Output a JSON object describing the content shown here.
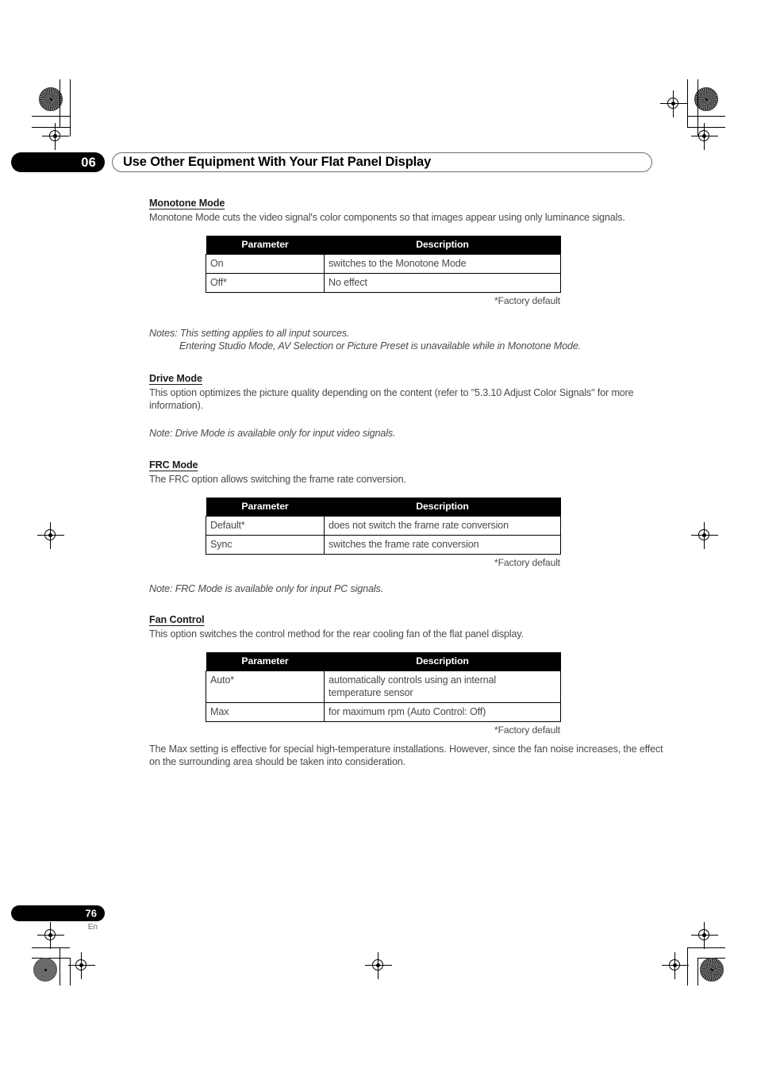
{
  "header": {
    "chapter_number": "06",
    "title": "Use Other Equipment With Your Flat Panel Display"
  },
  "footer": {
    "page_number": "76",
    "language_code": "En"
  },
  "sections": [
    {
      "heading": "Monotone Mode",
      "intro": "Monotone Mode cuts the video signal's color components so that images appear using only luminance signals.",
      "table": {
        "columns": [
          "Parameter",
          "Description"
        ],
        "rows": [
          [
            "On",
            "switches to the Monotone Mode"
          ],
          [
            "Off*",
            "No effect"
          ]
        ],
        "footnote": "*Factory default"
      },
      "notes": [
        "Notes: This setting applies to all input sources.",
        "Entering Studio Mode, AV Selection or Picture Preset is unavailable while in Monotone Mode."
      ]
    },
    {
      "heading": "Drive Mode",
      "intro": "This option optimizes the picture quality depending on the content (refer to \"5.3.10 Adjust Color Signals\" for more information).",
      "notes": [
        "Note: Drive Mode is available only for input video signals."
      ]
    },
    {
      "heading": "FRC Mode",
      "intro": "The FRC option allows switching the frame rate conversion.",
      "table": {
        "columns": [
          "Parameter",
          "Description"
        ],
        "rows": [
          [
            "Default*",
            "does not switch the frame rate conversion"
          ],
          [
            "Sync",
            "switches the frame rate conversion"
          ]
        ],
        "footnote": "*Factory default"
      },
      "notes": [
        "Note: FRC Mode is available only for input PC signals."
      ]
    },
    {
      "heading": "Fan Control",
      "intro": "This option switches the control method for the rear cooling fan of the flat panel display.",
      "table": {
        "columns": [
          "Parameter",
          "Description"
        ],
        "rows": [
          [
            "Auto*",
            "automatically controls using an internal temperature sensor"
          ],
          [
            "Max",
            "for maximum rpm (Auto Control: Off)"
          ]
        ],
        "footnote": "*Factory default"
      },
      "closing": "The Max setting is effective for special high-temperature installations. However, since the fan noise increases, the effect on the surrounding area should be taken into consideration."
    }
  ]
}
